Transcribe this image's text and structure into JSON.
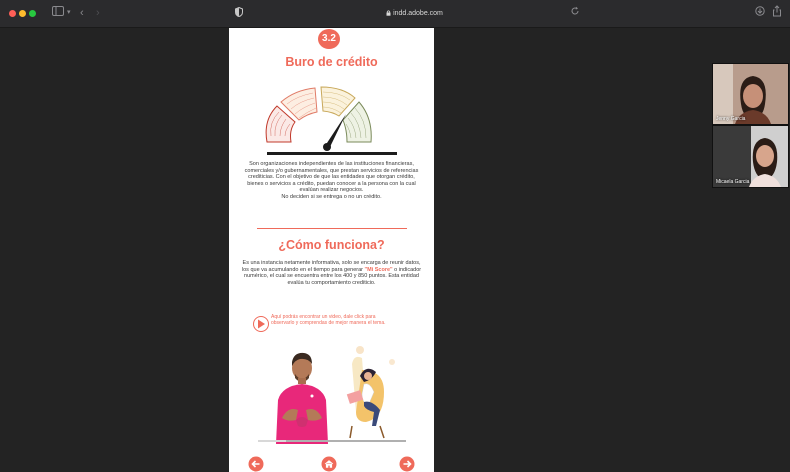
{
  "browser": {
    "url": "indd.adobe.com",
    "traffic_lights": [
      "#ff5f57",
      "#febc2e",
      "#28c840"
    ]
  },
  "doc": {
    "badge": "3.2",
    "title": "Buro de crédito",
    "paragraph1": "Son organizaciones independientes de las instituciones financieras, comerciales y/o gubernamentales, que prestan servicios de referencias crediticias. Con el objetivo de que las entidades que otorgan crédito, bienes o servicios a crédito, puedan conocer a la persona con la cual evalúan realizar negocios.",
    "paragraph1b": "No deciden si se entrega o no un crédito.",
    "subtitle": "¿Cómo funciona?",
    "p2_before": "Es una instancia netamente informativa, solo se encarga de reunir datos, los que va acumulando en el tiempo para generar ",
    "p2_highlight": "\"Mi Score\"",
    "p2_after": " o indicador numérico, el cual se encuentra entre los 400 y 850 puntos. Esta entidad evalúa tu comportamiento crediticio.",
    "video_note": "Aquí podrás encontrar un video, dale click para observarlo y comprendas de mejor manera el tema.",
    "accent_color": "#ef6a5a"
  },
  "participants": [
    {
      "name": "Jenny Garcia"
    },
    {
      "name": "Micaela Garcia"
    }
  ]
}
